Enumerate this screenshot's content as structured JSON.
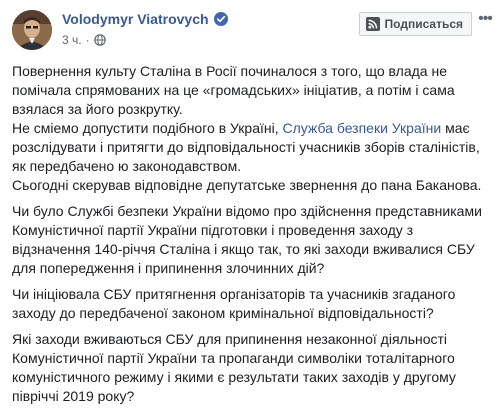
{
  "post": {
    "author": "Volodymyr Viatrovych",
    "time": "3 ч.",
    "separator": "·",
    "subscribe_label": "Подписаться",
    "icons": {
      "avatar": "avatar",
      "verified": "verified-badge-icon",
      "privacy": "globe-icon",
      "rss": "rss-icon",
      "more": "more-options-icon"
    },
    "colors": {
      "link": "#385898",
      "text": "#1c1e21",
      "verified": "#4267b2"
    }
  },
  "paragraphs": {
    "p1": {
      "s1": "Повернення культу Сталіна в Росії починалося з того, що влада не помічала спрямованих на це «громадських» ініціатив, а потім і сама взялася за його розкрутку.",
      "s2_before": "Не смiемо допустити подібного в Україні,",
      "s2_link": "Служба безпеки України",
      "s2_after": "має розслідувати і притягти до відповідальності учасників зборів сталіністів, як передбачено ю законодавством.",
      "s3": "Сьогодні скерував відповідне депутатське звернення до пана Баканова."
    },
    "p2": "Чи було Службі безпеки України відомо про здійснення представниками Комуністичної партії України підготовки і проведення заходу з відзначення 140-річчя Сталіна і якщо так, то які заходи вживалися СБУ для попередження і припинення злочинних дій?",
    "p3": "Чи ініціювала СБУ притягнення організаторів та учасників згаданого заходу до передбаченої законом кримінальної відповідальності?",
    "p4": "Які заходи вживаються СБУ для припинення незаконної діяльності Комуністичної партії України та пропаганди символіки тоталітарного комуністичного режиму і якими є результати таких заходів у другому півріччі 2019 року?"
  }
}
